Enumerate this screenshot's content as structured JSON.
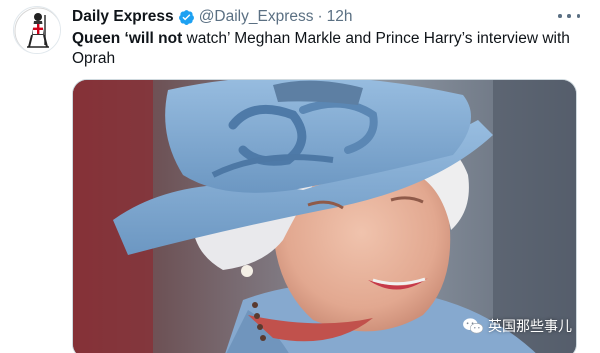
{
  "tweet": {
    "author_name": "Daily Express",
    "handle": "@Daily_Express",
    "separator": "·",
    "time": "12h",
    "text_parts": {
      "bold1": "Queen ",
      "bold2": "‘will not",
      "rest1": " watch’ Meghan Markle and Prince Harry’s interview with Oprah"
    }
  },
  "icons": {
    "verified": "verified-badge-icon",
    "more": "more-options-icon",
    "watermark": "wechat-icon"
  },
  "colors": {
    "verified": "#1da1f2",
    "secondary_text": "#5b7083",
    "hat": "#7ea6d0"
  },
  "watermark": {
    "text": "英国那些事儿"
  }
}
